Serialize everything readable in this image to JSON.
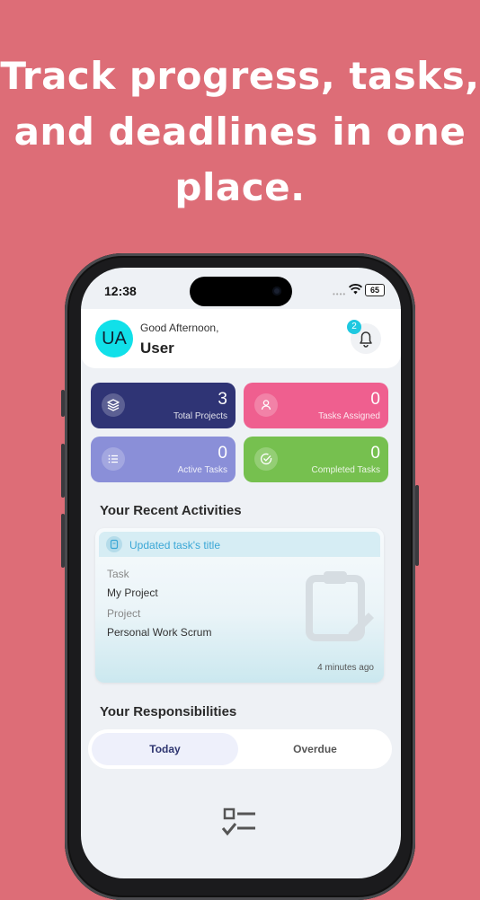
{
  "headline": "Track progress, tasks, and deadlines in one place.",
  "status": {
    "time": "12:38",
    "battery": "65"
  },
  "header": {
    "avatar_initials": "UA",
    "greeting": "Good Afternoon,",
    "user_name": "User",
    "notification_count": "2"
  },
  "stats": [
    {
      "value": "3",
      "label": "Total Projects",
      "color": "#2f3475"
    },
    {
      "value": "0",
      "label": "Tasks Assigned",
      "color": "#ef5f8f"
    },
    {
      "value": "0",
      "label": "Active Tasks",
      "color": "#8a8fd8"
    },
    {
      "value": "0",
      "label": "Completed Tasks",
      "color": "#76c04f"
    }
  ],
  "recent": {
    "title": "Your Recent Activities",
    "activity": {
      "title": "Updated task's title",
      "task_label": "Task",
      "task_value": "My Project",
      "project_label": "Project",
      "project_value": "Personal Work Scrum",
      "time_ago": "4 minutes ago"
    }
  },
  "responsibilities": {
    "title": "Your Responsibilities",
    "tabs": [
      "Today",
      "Overdue"
    ]
  },
  "colors": {
    "background": "#dd6d77",
    "accent": "#1ec8e0"
  }
}
